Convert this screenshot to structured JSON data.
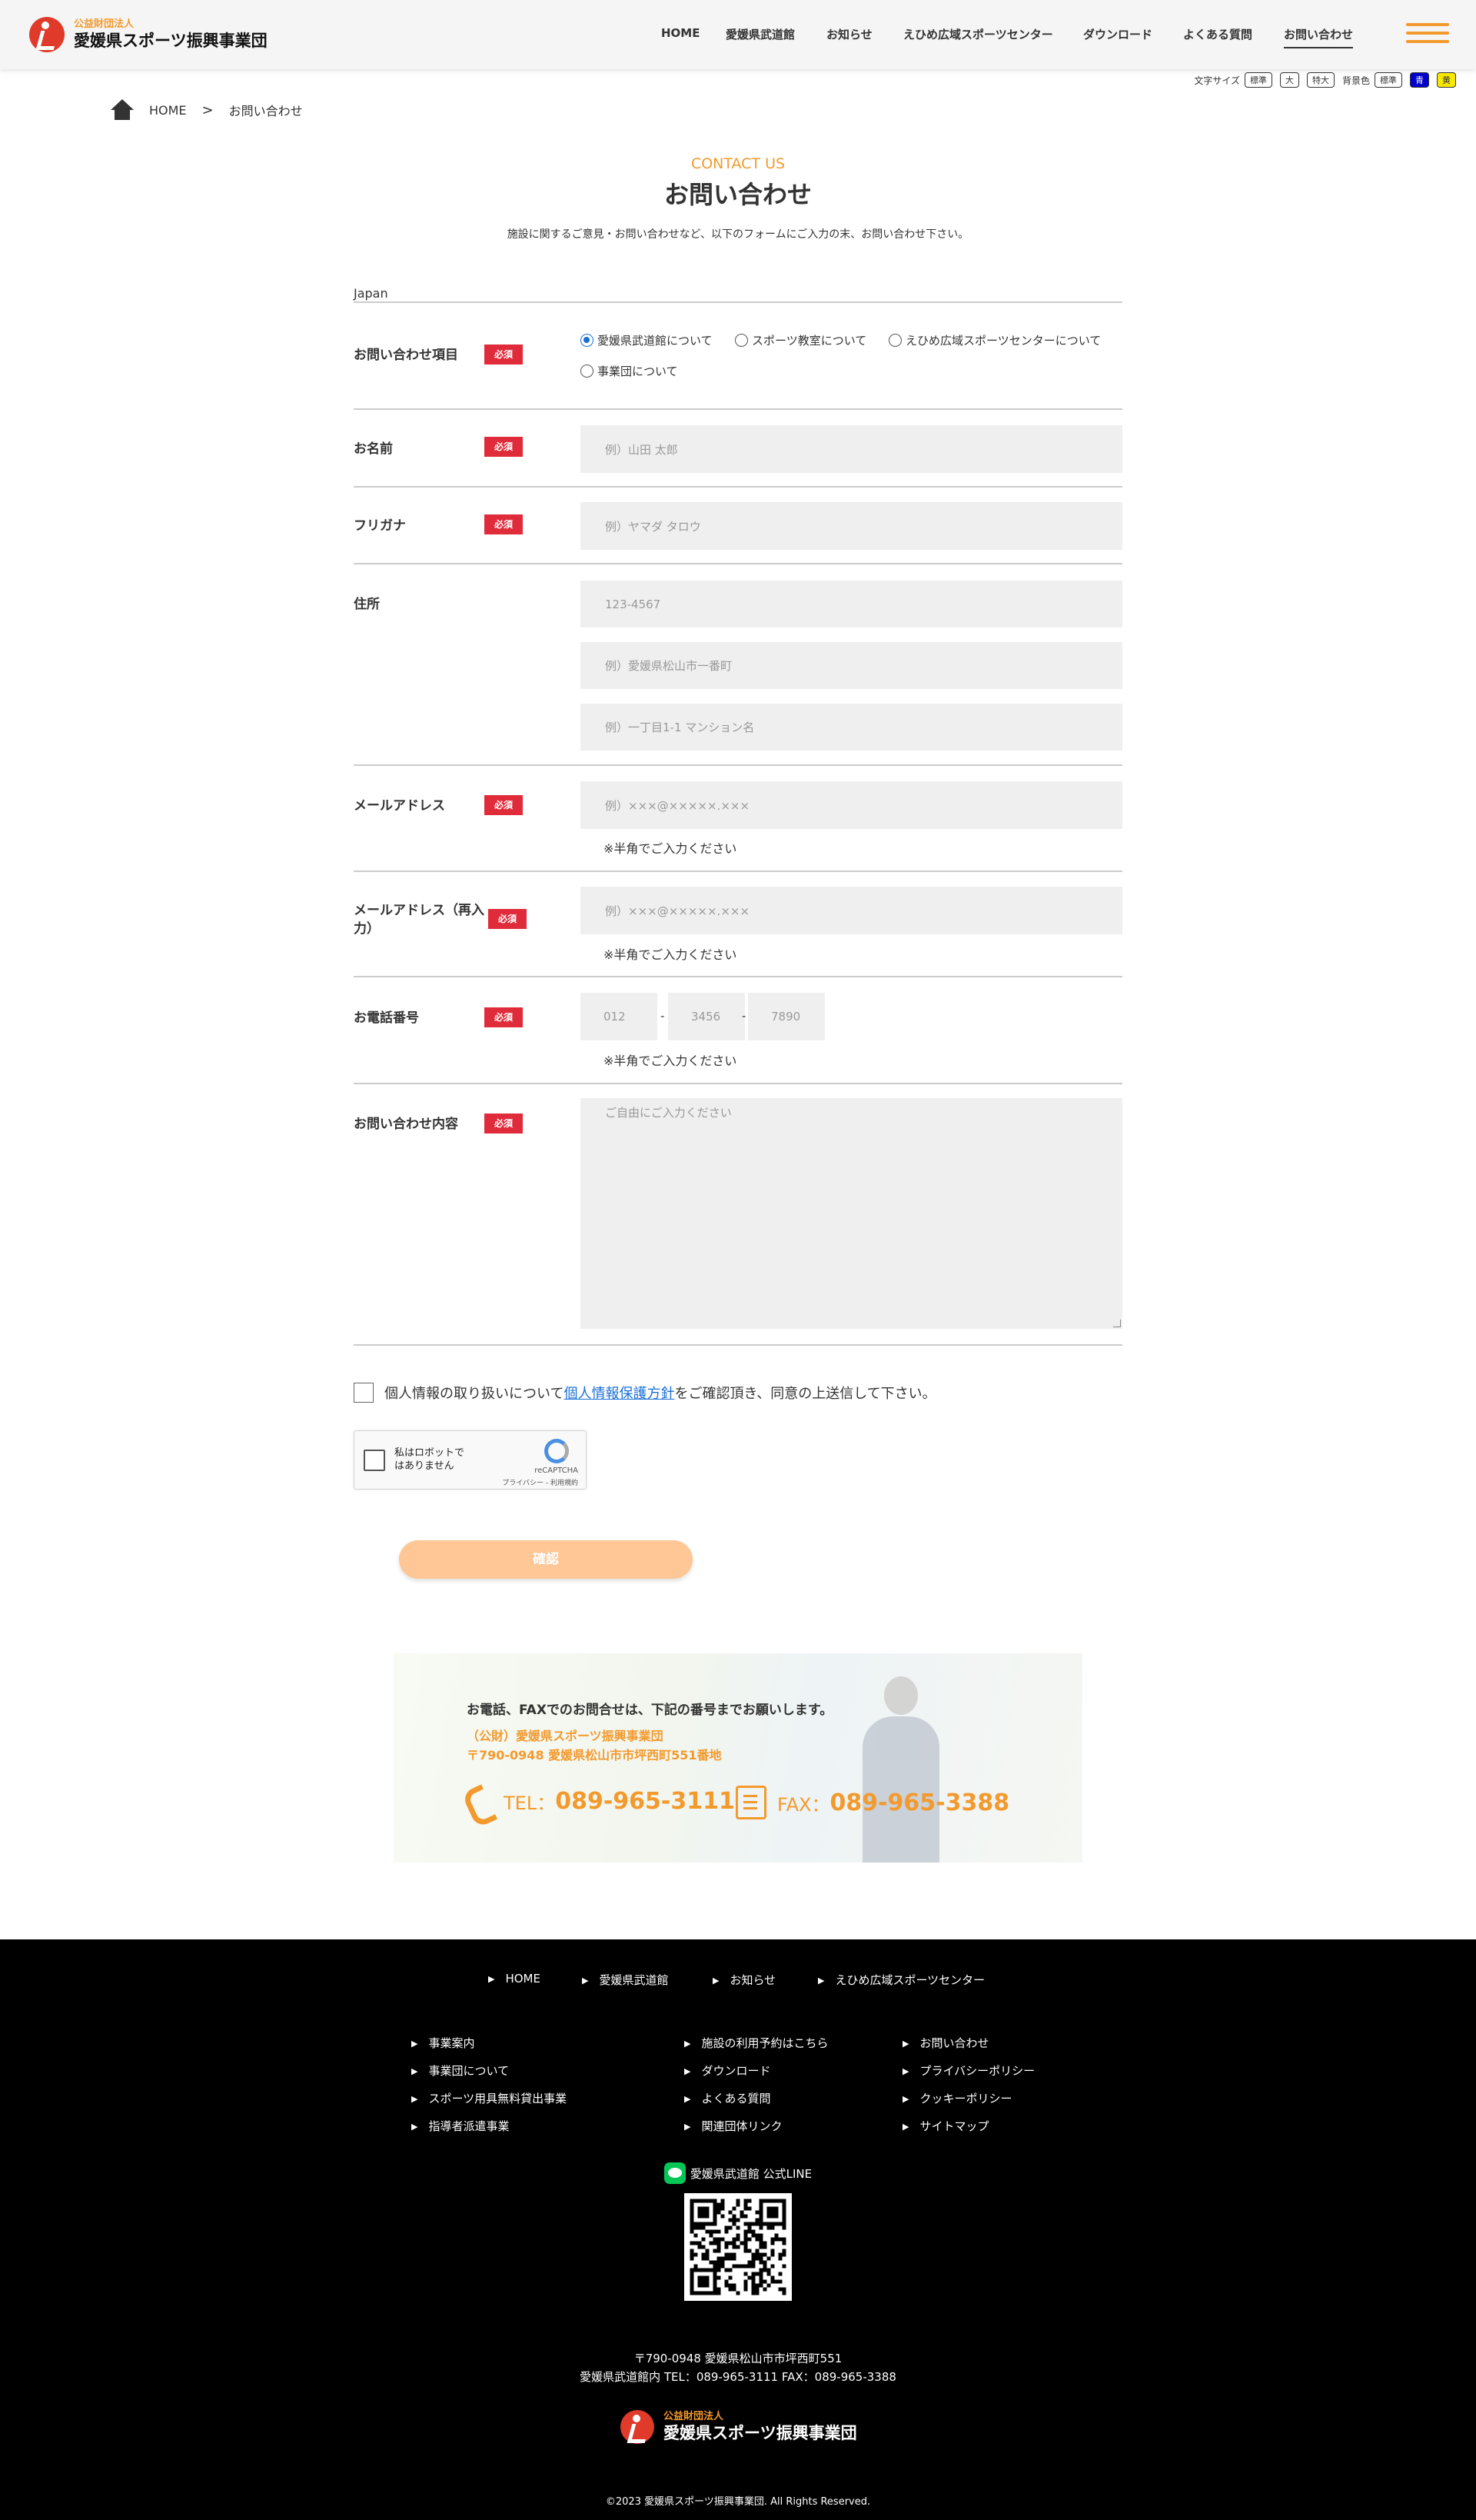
{
  "header": {
    "logo_sub": "公益財団法人",
    "logo_main": "愛媛県スポーツ振興事業団",
    "nav": [
      "HOME",
      "愛媛県武道館",
      "お知らせ",
      "えひめ広域スポーツセンター",
      "ダウンロード",
      "よくある質問",
      "お問い合わせ"
    ],
    "active_nav": "お問い合わせ"
  },
  "accessibility": {
    "font_size_label": "文字サイズ",
    "font_sizes": [
      "標準",
      "大",
      "特大"
    ],
    "bg_label": "背景色",
    "bg_options": [
      "標準",
      "青",
      "黄"
    ]
  },
  "breadcrumb": {
    "home": "HOME",
    "separator": ">",
    "current": "お問い合わせ"
  },
  "page": {
    "title_en": "CONTACT US",
    "title_jp": "お問い合わせ",
    "lead": "施設に関するご意見・お問い合わせなど、以下のフォームにご入力の末、お問い合わせ下さい。"
  },
  "form": {
    "country": "Japan",
    "required_label": "必須",
    "inquiry": {
      "label": "お問い合わせ項目",
      "options": [
        "愛媛県武道館について",
        "スポーツ教室について",
        "えひめ広域スポーツセンターについて",
        "事業団について"
      ],
      "selected": "愛媛県武道館について"
    },
    "name": {
      "label": "お名前",
      "placeholder": "例）山田 太郎"
    },
    "kana": {
      "label": "フリガナ",
      "placeholder": "例）ヤマダ タロウ"
    },
    "address": {
      "label": "住所",
      "zip_placeholder": "123-4567",
      "line1_placeholder": "例）愛媛県松山市一番町",
      "line2_placeholder": "例）一丁目1-1 マンション名"
    },
    "email": {
      "label": "メールアドレス",
      "placeholder": "例）×××@×××××.×××",
      "note": "※半角でご入力ください"
    },
    "email_confirm": {
      "label": "メールアドレス（再入力）",
      "placeholder": "例）×××@×××××.×××",
      "note": "※半角でご入力ください"
    },
    "tel": {
      "label": "お電話番号",
      "placeholders": [
        "012",
        "3456",
        "7890"
      ],
      "separator": "-",
      "note": "※半角でご入力ください"
    },
    "message": {
      "label": "お問い合わせ内容",
      "placeholder": "ご自由にご入力ください"
    },
    "privacy": {
      "before": "個人情報の取り扱いについて",
      "link": "個人情報保護方針",
      "after": "をご確認頂き、同意の上送信して下さい。"
    },
    "recaptcha": {
      "text": "私はロボットではありません",
      "brand": "reCAPTCHA",
      "links": "プライバシー - 利用規約"
    },
    "submit_label": "確認"
  },
  "contact": {
    "lead": "お電話、FAXでのお問合せは、下記の番号までお願いします。",
    "org": "（公財）愛媛県スポーツ振興事業団",
    "address": "〒790-0948 愛媛県松山市市坪西町551番地",
    "tel_label": "TEL：",
    "tel": "089-965-3111",
    "fax_label": "FAX：",
    "fax": "089-965-3388"
  },
  "footer": {
    "top_links": [
      "HOME",
      "愛媛県武道館",
      "お知らせ",
      "えひめ広域スポーツセンター"
    ],
    "col1": [
      "事業案内",
      "事業団について",
      "スポーツ用具無料貸出事業",
      "指導者派遣事業"
    ],
    "col2": [
      "施設の利用予約はこちら",
      "ダウンロード",
      "よくある質問",
      "関連団体リンク"
    ],
    "col3": [
      "お問い合わせ",
      "プライバシーポリシー",
      "クッキーポリシー",
      "サイトマップ"
    ],
    "line_label": "愛媛県武道館 公式LINE",
    "address1": "〒790-0948 愛媛県松山市市坪西町551",
    "address2": "愛媛県武道館内 TEL：089-965-3111 FAX：089-965-3388",
    "logo_sub": "公益財団法人",
    "logo_main": "愛媛県スポーツ振興事業団",
    "copyright": "©2023 愛媛県スポーツ振興事業団. All Rights Reserved."
  },
  "colors": {
    "accent": "#f39a2e",
    "required": "#e02b3a",
    "submit": "#fec795",
    "link": "#1a6fd6"
  }
}
